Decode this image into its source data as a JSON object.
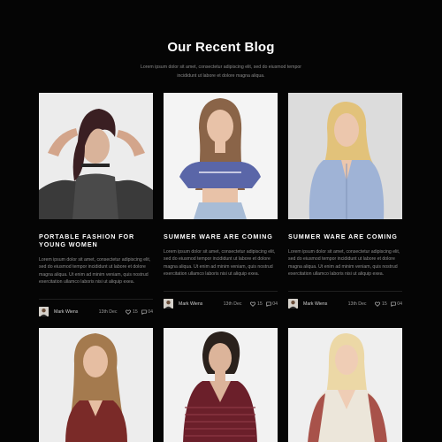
{
  "header": {
    "title": "Our Recent Blog",
    "subtitle": "Lorem ipsum dolor sit amet, consectetur adipiscing elit, sed do eiusmod tempor incididunt ut labore et dolore magna aliqua."
  },
  "posts": [
    {
      "title": "Portable Fashion for young women",
      "excerpt": "Lorem ipsum dolor sit amet, consectetur adipiscing elit, sed do eiusmod tempor incididunt ut labore et dolore magna aliqua. Ut enim ad minim veniam, quis nostrud exercitation ullamco laboris nisi ut aliquip exea.",
      "author": "Mark Wiens",
      "date": "13th Dec",
      "likes": "15",
      "comments": "04"
    },
    {
      "title": "Summer ware are coming",
      "excerpt": "Lorem ipsum dolor sit amet, consectetur adipiscing elit, sed do eiusmod tempor incididunt ut labore et dolore magna aliqua. Ut enim ad minim veniam, quis nostrud exercitation ullamco laboris nisi ut aliquip exea.",
      "author": "Mark Wiens",
      "date": "13th Dec",
      "likes": "15",
      "comments": "04"
    },
    {
      "title": "Summer ware are coming",
      "excerpt": "Lorem ipsum dolor sit amet, consectetur adipiscing elit, sed do eiusmod tempor incididunt ut labore et dolore magna aliqua. Ut enim ad minim veniam, quis nostrud exercitation ullamco laboris nisi ut aliquip exea.",
      "author": "Mark Wiens",
      "date": "13th Dec",
      "likes": "15",
      "comments": "04"
    }
  ],
  "icons": {
    "like": "heart-icon",
    "comment": "comment-icon"
  },
  "colors": {
    "background": "#050505",
    "text": "#ffffff",
    "muted": "#8f8f8f"
  }
}
